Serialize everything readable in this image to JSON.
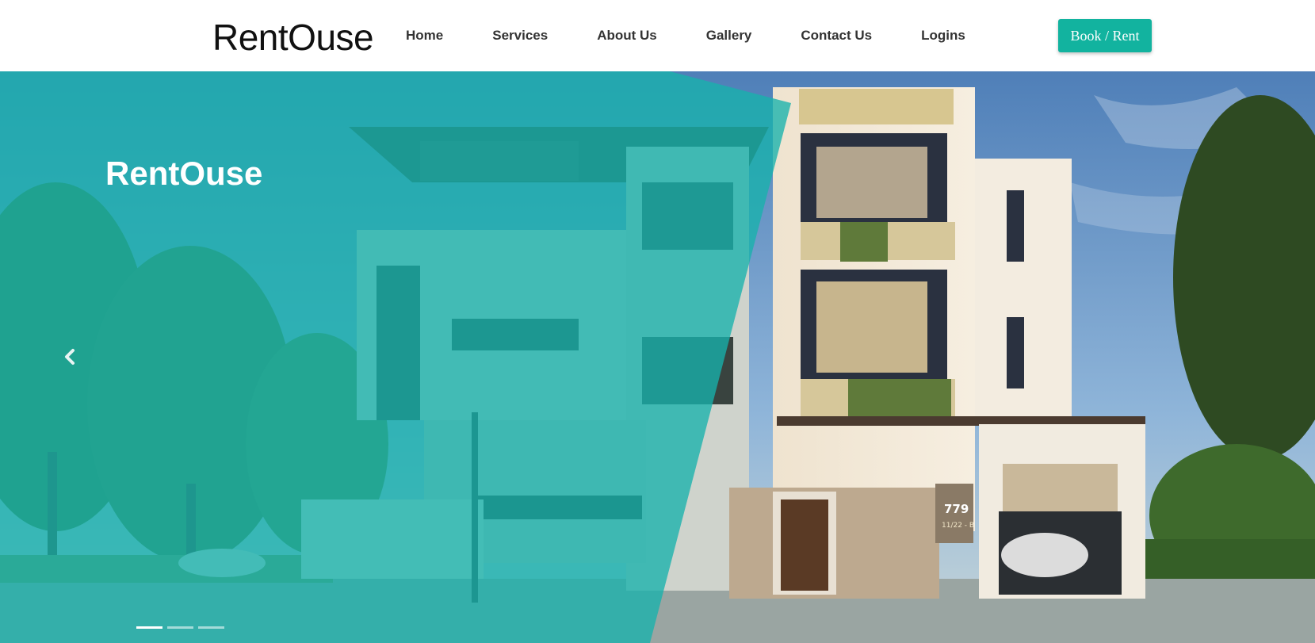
{
  "header": {
    "brand": "RentOuse",
    "nav": [
      {
        "label": "Home"
      },
      {
        "label": "Services"
      },
      {
        "label": "About Us"
      },
      {
        "label": "Gallery"
      },
      {
        "label": "Contact Us"
      },
      {
        "label": "Logins"
      }
    ],
    "cta_label": "Book / Rent"
  },
  "hero": {
    "title": "RentOuse",
    "house_number": "779",
    "house_sub": "11/22 - B",
    "slides_count": 3,
    "active_slide": 1,
    "prev_icon": "chevron-left-icon"
  },
  "colors": {
    "accent": "#12b39f",
    "overlay": "#17b2ac",
    "sky": "#6e9cc9"
  }
}
